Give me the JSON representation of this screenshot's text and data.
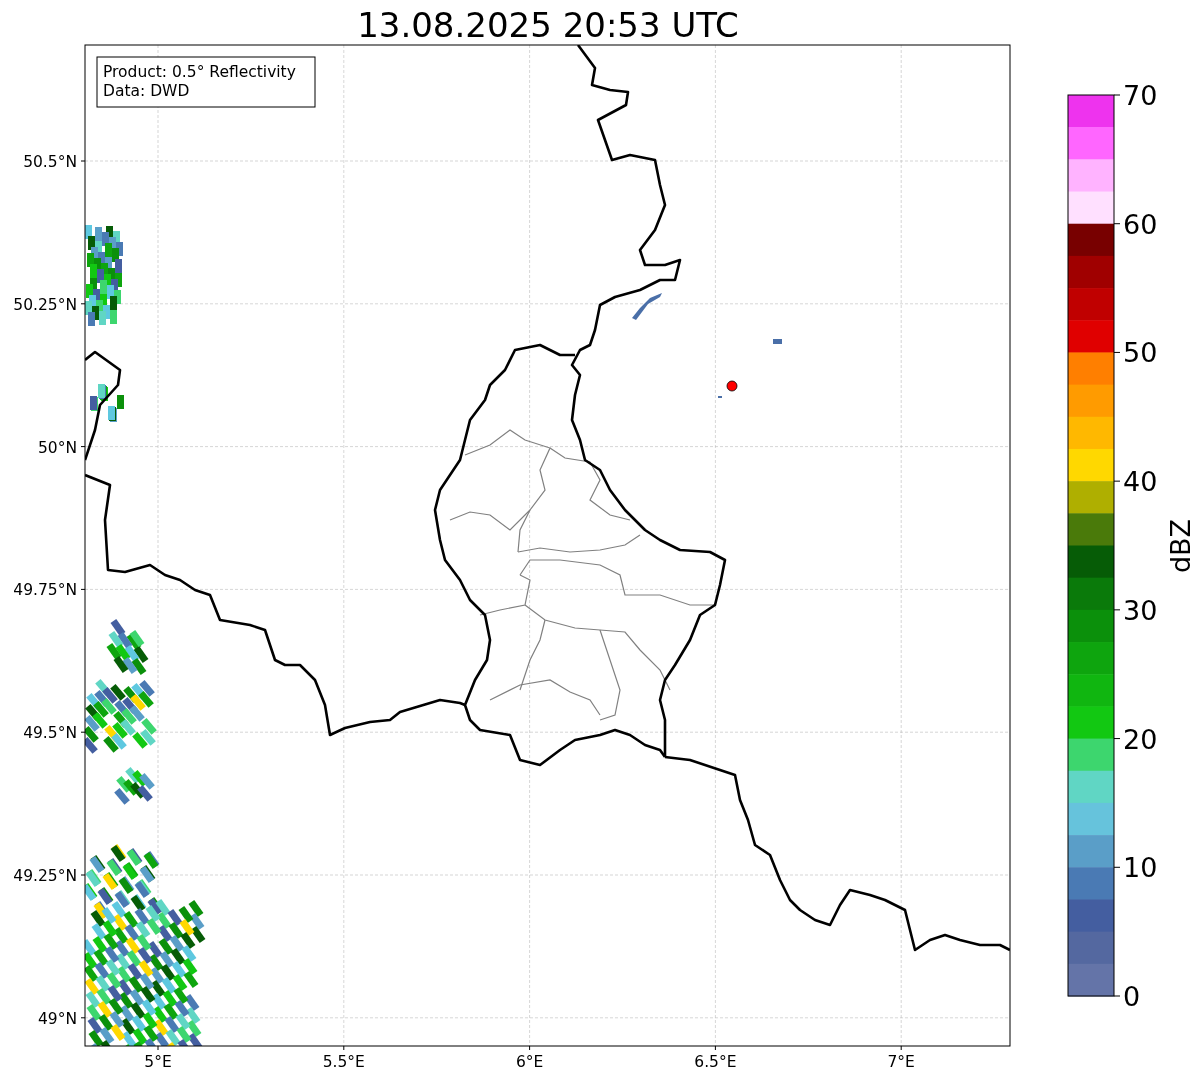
{
  "title": "13.08.2025 20:53 UTC",
  "legend": [
    "Product: 0.5° Reflectivity",
    "Data: DWD"
  ],
  "map": {
    "lat_labels": [
      "50.5°N",
      "50.25°N",
      "50°N",
      "49.75°N",
      "49.5°N",
      "49.25°N",
      "49°N"
    ],
    "lon_labels": [
      "5°E",
      "5.5°E",
      "6°E",
      "6.5°E",
      "7°E"
    ]
  },
  "colorbar": {
    "label": "dBZ",
    "ticks": [
      "70",
      "60",
      "50",
      "40",
      "30",
      "20",
      "10",
      "0"
    ],
    "bins": [
      {
        "color": "#ee33ee"
      },
      {
        "color": "#ff66ff"
      },
      {
        "color": "#ffb3ff"
      },
      {
        "color": "#ffe0ff"
      },
      {
        "color": "#780000"
      },
      {
        "color": "#a00000"
      },
      {
        "color": "#c00000"
      },
      {
        "color": "#e00000"
      },
      {
        "color": "#ff7f00"
      },
      {
        "color": "#ff9b00"
      },
      {
        "color": "#ffb800"
      },
      {
        "color": "#ffd800"
      },
      {
        "color": "#afaf00"
      },
      {
        "color": "#4a7a0a"
      },
      {
        "color": "#065c06"
      },
      {
        "color": "#0a7a0a"
      },
      {
        "color": "#0b900b"
      },
      {
        "color": "#0ea50e"
      },
      {
        "color": "#10b610"
      },
      {
        "color": "#12c812"
      },
      {
        "color": "#3dd66e"
      },
      {
        "color": "#60d6c4"
      },
      {
        "color": "#66c3dc"
      },
      {
        "color": "#5a9ec8"
      },
      {
        "color": "#4a7ab4"
      },
      {
        "color": "#445ea0"
      },
      {
        "color": "#5468a0"
      },
      {
        "color": "#6474a8"
      }
    ]
  }
}
